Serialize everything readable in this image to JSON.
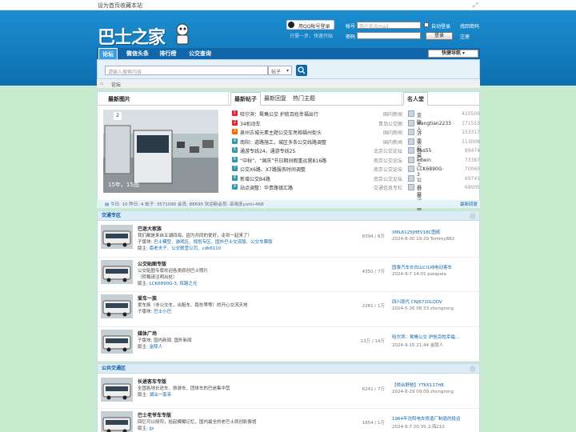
{
  "topbar": {
    "set_home": "设为首页",
    "bookmark": "收藏本站"
  },
  "header": {
    "logo_text": "巴士之家",
    "qq_login": "用QQ帐号登录",
    "reg_step": "只需一步，快速开始",
    "account_label": "帐号",
    "account_placeholder": "用户名/Email",
    "auto_login": "自动登录",
    "forgot": "找回密码",
    "password_label": "密码",
    "login_button": "登录",
    "register": "注册"
  },
  "nav": {
    "items": [
      "论坛",
      "微信头条",
      "排行榜",
      "公交查询"
    ],
    "quick_nav": "快捷导航"
  },
  "search": {
    "placeholder": "请输入搜索内容",
    "type": "帖子"
  },
  "breadcrumb": {
    "item": "论坛"
  },
  "latest_photo": {
    "title": "最新图片",
    "caption": "15年，15图",
    "index": "2"
  },
  "posts": {
    "tabs": [
      "最新帖子",
      "最新回复",
      "热门主题"
    ],
    "items": [
      {
        "n": "1",
        "title": "哈尔滨：鸳鸯公交 护航百姓幸福出行",
        "cat": "国内新闻"
      },
      {
        "n": "2",
        "title": "34机动车",
        "cat": "青岛公交图"
      },
      {
        "n": "3",
        "title": "泉州古城元素主题公交车亮相福州街头",
        "cat": "国内新闻"
      },
      {
        "n": "4",
        "title": "南阳：道路施工，城区多条公交线路调整",
        "cat": "国内新闻"
      },
      {
        "n": "5",
        "title": "通游专线24，通游专线25",
        "cat": "北京公交论坛"
      },
      {
        "n": "6",
        "title": "“中秋”、“国庆”节日期间假重运营B16路",
        "cat": "南京公交论坛"
      },
      {
        "n": "7",
        "title": "公交X6路、X7路服务时间调整",
        "cat": "南京公交论坛"
      },
      {
        "n": "8",
        "title": "新增公交B4路",
        "cat": "南京公交论坛"
      },
      {
        "n": "9",
        "title": "站点调整：华贵路镇汇路",
        "cat": "交通信息专栏"
      }
    ]
  },
  "fame": {
    "title": "名人堂",
    "users": [
      {
        "name": "金陵人",
        "val": "410509"
      },
      {
        "name": "wangtian2233",
        "val": "171553"
      },
      {
        "name": "济南公交",
        "val": "153317"
      },
      {
        "name": "木马巴士",
        "val": "113008"
      },
      {
        "name": "bus55",
        "val": "89474"
      },
      {
        "name": "edwin",
        "val": "73387"
      },
      {
        "name": "LCK6890G-3",
        "val": "70060"
      },
      {
        "name": "公共交通",
        "val": "69741"
      },
      {
        "name": "公交联营公司",
        "val": "69005"
      }
    ]
  },
  "stats": {
    "text": "今日: 10   昨日: 4   帖子: 3571090   会员: 88695   欢迎新会员: 岳晓彦yumi-468",
    "latest_reply": "最新回复"
  },
  "sections": [
    {
      "title": "交通专区",
      "forums": [
        {
          "name": "巴迷大家族",
          "desc": "我们都是来自五湖四海，因为共同的爱好，走到一起来了！",
          "mod_label": "子版块: ",
          "mod": "巴士模型、游戏区、规划专区、国外巴士交流版、公交车票版",
          "mod2_label": "版主: ",
          "mod2": "南老夫子、公交联营公司、cdk6110",
          "count": "8394 / 6万",
          "last_title": "XML6125JHEV18C图纸",
          "last_date": "2024-8-30 19:29 Tommy882"
        },
        {
          "name": "公交贴图专版",
          "desc": "公交贴图专版欢迎各类原创巴士照片",
          "mod_label": "（转载请注明出处）",
          "mod": "",
          "mod2_label": "版主: ",
          "mod2": "LCK6890G-3, 挥路之光",
          "count": "4350 / 7万",
          "last_title": "固泰汽车长白山CI1纯电动客车",
          "last_date": "2024-9-7 14:01 palapala"
        },
        {
          "name": "爱车一族",
          "desc": "爱车族（非公交车，出租车、跑车等等）的开心交流天地",
          "mod_label": "子版块: ",
          "mod": "巴士小巴",
          "mod2_label": "",
          "mod2": "",
          "count": "2281 / 1万",
          "last_title": "四川现代 CNJ6710LQDV",
          "last_date": "2024-5-26 08:33 zhongrong"
        },
        {
          "name": "媒体广场",
          "desc": "子版块: 国内新闻, 国外新闻",
          "mod_label": "版主: ",
          "mod": "金陵人",
          "mod2_label": "",
          "mod2": "",
          "count": "13万 / 14万",
          "last_title": "哈尔滨：鸳鸯公交 护航百姓幸福...",
          "last_date": "2024-9-15 21:44 金陵人"
        }
      ]
    },
    {
      "title": "公共交通区",
      "forums": [
        {
          "name": "长途客车专版",
          "desc": "全国各地长途车、旅游车、团体车的巴迷集中营",
          "mod_label": "版主: ",
          "mod": "湖汕一家亲",
          "mod2_label": "",
          "mod2": "",
          "count": "6241 / 7万",
          "last_title": "【倾台舒驰】YTK6117HE",
          "last_date": "2024-8-29 09:09 zhongrong"
        },
        {
          "name": "巴士老爷车专版",
          "desc": "回忆可以侧帘，拾起模糊记忆，国内最全的老巴士原创影像馆",
          "mod_label": "版主: ",
          "mod": "jjs",
          "mod2_label": "",
          "mod2": "",
          "count": "1854 / 1万",
          "last_title": "1964年沈阳电车修造厂制造的投运",
          "last_date": "2024-9-7 20:35 上海210"
        }
      ]
    }
  ],
  "colors": {
    "header": "#1c8ed0",
    "nav": "#1066a8",
    "page_bg": "#c8ebcf"
  }
}
